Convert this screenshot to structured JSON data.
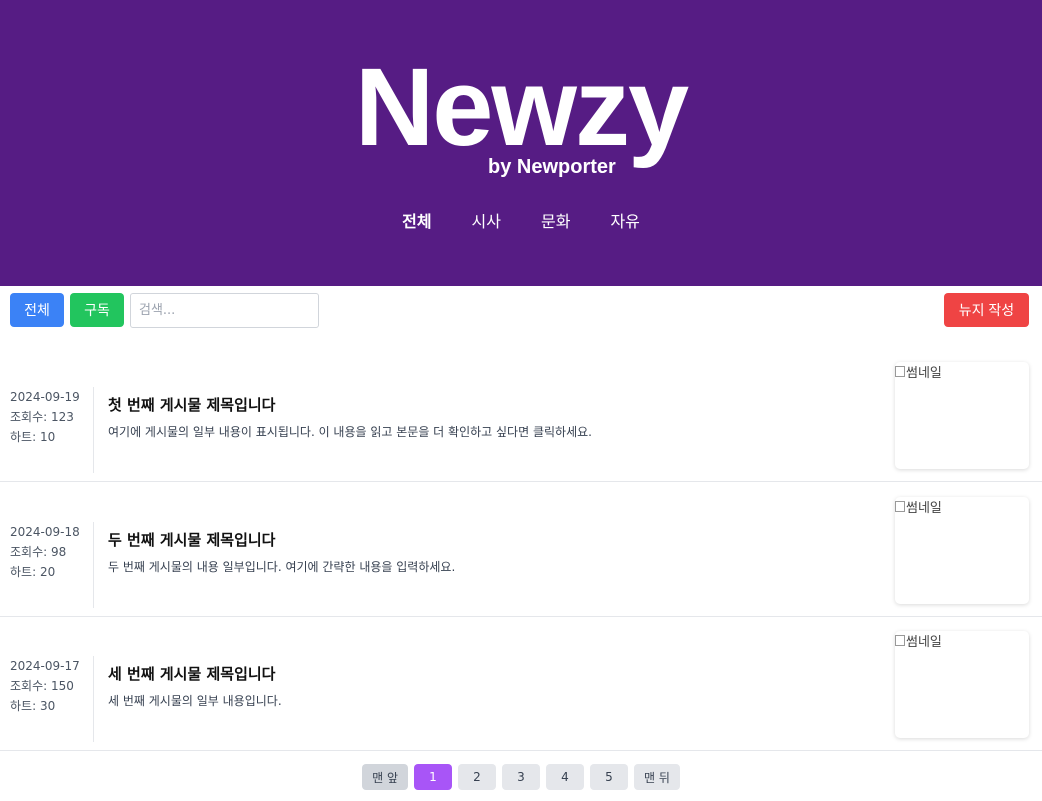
{
  "brand": {
    "logo": "Newzy",
    "byline": "by Newporter"
  },
  "nav": [
    "전체",
    "시사",
    "문화",
    "자유"
  ],
  "toolbar": {
    "all_label": "전체",
    "subscribe_label": "구독",
    "search_placeholder": "검색...",
    "write_label": "뉴지 작성"
  },
  "posts": [
    {
      "date": "2024-09-19",
      "views": "조회수: 123",
      "hearts": "하트: 10",
      "title": "첫 번째 게시물 제목입니다",
      "excerpt": "여기에 게시물의 일부 내용이 표시됩니다. 이 내용을 읽고 본문을 더 확인하고 싶다면 클릭하세요.",
      "thumb_alt": "썸네일"
    },
    {
      "date": "2024-09-18",
      "views": "조회수: 98",
      "hearts": "하트: 20",
      "title": "두 번째 게시물 제목입니다",
      "excerpt": "두 번째 게시물의 내용 일부입니다. 여기에 간략한 내용을 입력하세요.",
      "thumb_alt": "썸네일"
    },
    {
      "date": "2024-09-17",
      "views": "조회수: 150",
      "hearts": "하트: 30",
      "title": "세 번째 게시물 제목입니다",
      "excerpt": "세 번째 게시물의 일부 내용입니다.",
      "thumb_alt": "썸네일"
    }
  ],
  "pagination": {
    "first": "맨 앞",
    "pages": [
      "1",
      "2",
      "3",
      "4",
      "5"
    ],
    "last": "맨 뒤",
    "current": "1"
  },
  "colors": {
    "header": "#561c84",
    "all_button": "#3b82f6",
    "subscribe_button": "#22c55e",
    "write_button": "#ef4444",
    "active_page": "#a855f7"
  }
}
